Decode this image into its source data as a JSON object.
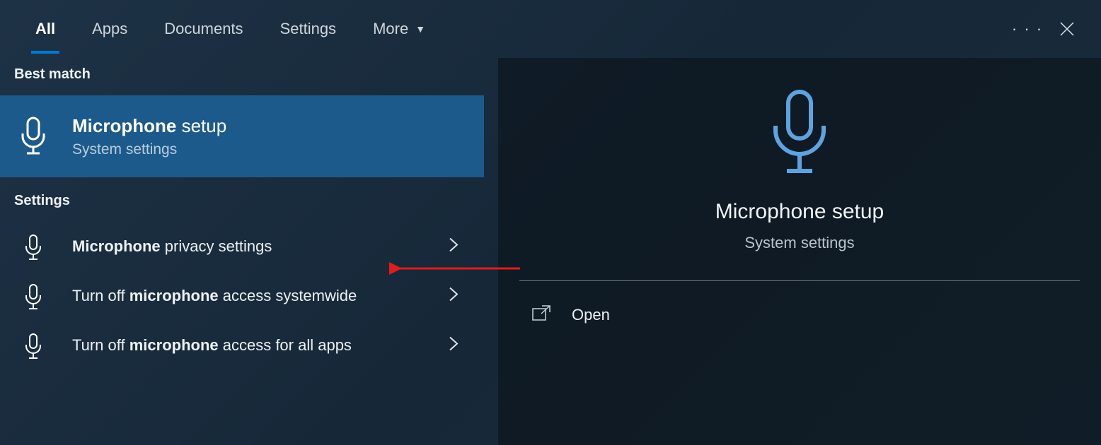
{
  "tabs": {
    "all": "All",
    "apps": "Apps",
    "documents": "Documents",
    "settings": "Settings",
    "more": "More"
  },
  "left": {
    "best_match_label": "Best match",
    "best_match": {
      "title_bold": "Microphone",
      "title_rest": " setup",
      "subtitle": "System settings"
    },
    "settings_label": "Settings",
    "items": [
      {
        "pre": "",
        "bold": "Microphone",
        "post": " privacy settings"
      },
      {
        "pre": "Turn off ",
        "bold": "microphone",
        "post": " access systemwide"
      },
      {
        "pre": "Turn off ",
        "bold": "microphone",
        "post": " access for all apps"
      }
    ]
  },
  "right": {
    "title": "Microphone setup",
    "subtitle": "System settings",
    "open": "Open"
  }
}
